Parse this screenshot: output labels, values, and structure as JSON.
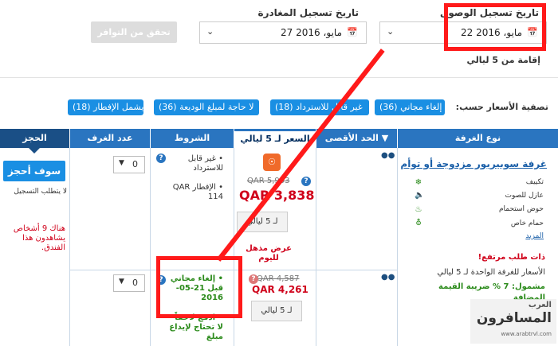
{
  "search": {
    "checkin_label": "تاريخ تسجيل الوصول",
    "checkout_label": "تاريخ تسجيل المغادرة",
    "checkin_value": "22 مايو، 2016",
    "checkout_value": "27 مايو، 2016",
    "check_button": "تحقق من التوافر",
    "stay_text": "إقامة من 5 ليالي"
  },
  "filters": {
    "label": "تصفية الأسعار حسب:",
    "chips": [
      "إلغاء مجاني (36)",
      "غير قابل للاسترداد (18)",
      "لا حاجة لمبلغ الوديعة (36)",
      "يشمل الإفطار (18)"
    ]
  },
  "table": {
    "headers": {
      "room_type": "نوع الغرفة",
      "max": "الحد الأقصى",
      "price": "السعر لـ 5 ليالي",
      "conditions": "الشروط",
      "rooms": "عدد الغرف",
      "booking": "الحجز"
    },
    "room_name": "غرفة سوبيريور مزدوجة أو توأم",
    "amenities": [
      "تكييف",
      "عازل للصوت",
      "حوض استحمام",
      "حمام خاص"
    ],
    "more_link": "المزيد",
    "high_demand": "ذات طلب مرتفع!",
    "per_room_text": "الأسعار للغرفة الواحدة لـ 5 ليالي",
    "tax_text": "مشمول: 7 % ضريبة القيمة المضافة",
    "row1": {
      "conditions": [
        "غير قابل للاسترداد",
        "الإفطار QAR 114"
      ],
      "old_price": "QAR 5,953",
      "price": "QAR 3,838",
      "nights_btn": "لـ 5 ليالي",
      "deal": "عرض مذهل لليوم",
      "rooms": "0"
    },
    "row2": {
      "conditions": [
        "إلغاء مجاني قبل 21-05-2016",
        "ادفع لاحقاً - لا تحتاج لإيداع مبلغ"
      ],
      "old_price": "QAR 4,587",
      "price": "QAR 4,261",
      "nights_btn": "لـ 5 ليالي",
      "rooms": "0"
    },
    "book_button": "سوف أحجز",
    "no_register": "لا يتطلب التسجيل",
    "viewers_text": "هناك 9 أشخاص يشاهدون هذا الفندق."
  },
  "watermark": {
    "brand": "المسافرون",
    "brand_top": "العرب",
    "url": "www.arabtrvl.com"
  },
  "colors": {
    "accent": "#1a8fe3",
    "header": "#2a75c0",
    "price": "#d0021b",
    "annotation": "#ff1a1a"
  }
}
